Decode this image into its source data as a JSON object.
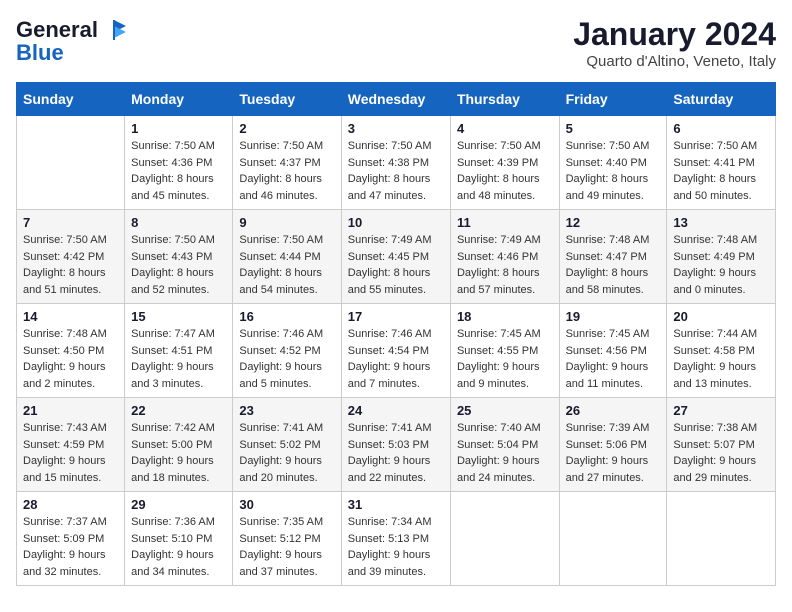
{
  "logo": {
    "line1": "General",
    "line2": "Blue"
  },
  "title": "January 2024",
  "location": "Quarto d'Altino, Veneto, Italy",
  "days_of_week": [
    "Sunday",
    "Monday",
    "Tuesday",
    "Wednesday",
    "Thursday",
    "Friday",
    "Saturday"
  ],
  "weeks": [
    [
      {
        "num": "",
        "sunrise": "",
        "sunset": "",
        "daylight": ""
      },
      {
        "num": "1",
        "sunrise": "Sunrise: 7:50 AM",
        "sunset": "Sunset: 4:36 PM",
        "daylight": "Daylight: 8 hours and 45 minutes."
      },
      {
        "num": "2",
        "sunrise": "Sunrise: 7:50 AM",
        "sunset": "Sunset: 4:37 PM",
        "daylight": "Daylight: 8 hours and 46 minutes."
      },
      {
        "num": "3",
        "sunrise": "Sunrise: 7:50 AM",
        "sunset": "Sunset: 4:38 PM",
        "daylight": "Daylight: 8 hours and 47 minutes."
      },
      {
        "num": "4",
        "sunrise": "Sunrise: 7:50 AM",
        "sunset": "Sunset: 4:39 PM",
        "daylight": "Daylight: 8 hours and 48 minutes."
      },
      {
        "num": "5",
        "sunrise": "Sunrise: 7:50 AM",
        "sunset": "Sunset: 4:40 PM",
        "daylight": "Daylight: 8 hours and 49 minutes."
      },
      {
        "num": "6",
        "sunrise": "Sunrise: 7:50 AM",
        "sunset": "Sunset: 4:41 PM",
        "daylight": "Daylight: 8 hours and 50 minutes."
      }
    ],
    [
      {
        "num": "7",
        "sunrise": "Sunrise: 7:50 AM",
        "sunset": "Sunset: 4:42 PM",
        "daylight": "Daylight: 8 hours and 51 minutes."
      },
      {
        "num": "8",
        "sunrise": "Sunrise: 7:50 AM",
        "sunset": "Sunset: 4:43 PM",
        "daylight": "Daylight: 8 hours and 52 minutes."
      },
      {
        "num": "9",
        "sunrise": "Sunrise: 7:50 AM",
        "sunset": "Sunset: 4:44 PM",
        "daylight": "Daylight: 8 hours and 54 minutes."
      },
      {
        "num": "10",
        "sunrise": "Sunrise: 7:49 AM",
        "sunset": "Sunset: 4:45 PM",
        "daylight": "Daylight: 8 hours and 55 minutes."
      },
      {
        "num": "11",
        "sunrise": "Sunrise: 7:49 AM",
        "sunset": "Sunset: 4:46 PM",
        "daylight": "Daylight: 8 hours and 57 minutes."
      },
      {
        "num": "12",
        "sunrise": "Sunrise: 7:48 AM",
        "sunset": "Sunset: 4:47 PM",
        "daylight": "Daylight: 8 hours and 58 minutes."
      },
      {
        "num": "13",
        "sunrise": "Sunrise: 7:48 AM",
        "sunset": "Sunset: 4:49 PM",
        "daylight": "Daylight: 9 hours and 0 minutes."
      }
    ],
    [
      {
        "num": "14",
        "sunrise": "Sunrise: 7:48 AM",
        "sunset": "Sunset: 4:50 PM",
        "daylight": "Daylight: 9 hours and 2 minutes."
      },
      {
        "num": "15",
        "sunrise": "Sunrise: 7:47 AM",
        "sunset": "Sunset: 4:51 PM",
        "daylight": "Daylight: 9 hours and 3 minutes."
      },
      {
        "num": "16",
        "sunrise": "Sunrise: 7:46 AM",
        "sunset": "Sunset: 4:52 PM",
        "daylight": "Daylight: 9 hours and 5 minutes."
      },
      {
        "num": "17",
        "sunrise": "Sunrise: 7:46 AM",
        "sunset": "Sunset: 4:54 PM",
        "daylight": "Daylight: 9 hours and 7 minutes."
      },
      {
        "num": "18",
        "sunrise": "Sunrise: 7:45 AM",
        "sunset": "Sunset: 4:55 PM",
        "daylight": "Daylight: 9 hours and 9 minutes."
      },
      {
        "num": "19",
        "sunrise": "Sunrise: 7:45 AM",
        "sunset": "Sunset: 4:56 PM",
        "daylight": "Daylight: 9 hours and 11 minutes."
      },
      {
        "num": "20",
        "sunrise": "Sunrise: 7:44 AM",
        "sunset": "Sunset: 4:58 PM",
        "daylight": "Daylight: 9 hours and 13 minutes."
      }
    ],
    [
      {
        "num": "21",
        "sunrise": "Sunrise: 7:43 AM",
        "sunset": "Sunset: 4:59 PM",
        "daylight": "Daylight: 9 hours and 15 minutes."
      },
      {
        "num": "22",
        "sunrise": "Sunrise: 7:42 AM",
        "sunset": "Sunset: 5:00 PM",
        "daylight": "Daylight: 9 hours and 18 minutes."
      },
      {
        "num": "23",
        "sunrise": "Sunrise: 7:41 AM",
        "sunset": "Sunset: 5:02 PM",
        "daylight": "Daylight: 9 hours and 20 minutes."
      },
      {
        "num": "24",
        "sunrise": "Sunrise: 7:41 AM",
        "sunset": "Sunset: 5:03 PM",
        "daylight": "Daylight: 9 hours and 22 minutes."
      },
      {
        "num": "25",
        "sunrise": "Sunrise: 7:40 AM",
        "sunset": "Sunset: 5:04 PM",
        "daylight": "Daylight: 9 hours and 24 minutes."
      },
      {
        "num": "26",
        "sunrise": "Sunrise: 7:39 AM",
        "sunset": "Sunset: 5:06 PM",
        "daylight": "Daylight: 9 hours and 27 minutes."
      },
      {
        "num": "27",
        "sunrise": "Sunrise: 7:38 AM",
        "sunset": "Sunset: 5:07 PM",
        "daylight": "Daylight: 9 hours and 29 minutes."
      }
    ],
    [
      {
        "num": "28",
        "sunrise": "Sunrise: 7:37 AM",
        "sunset": "Sunset: 5:09 PM",
        "daylight": "Daylight: 9 hours and 32 minutes."
      },
      {
        "num": "29",
        "sunrise": "Sunrise: 7:36 AM",
        "sunset": "Sunset: 5:10 PM",
        "daylight": "Daylight: 9 hours and 34 minutes."
      },
      {
        "num": "30",
        "sunrise": "Sunrise: 7:35 AM",
        "sunset": "Sunset: 5:12 PM",
        "daylight": "Daylight: 9 hours and 37 minutes."
      },
      {
        "num": "31",
        "sunrise": "Sunrise: 7:34 AM",
        "sunset": "Sunset: 5:13 PM",
        "daylight": "Daylight: 9 hours and 39 minutes."
      },
      {
        "num": "",
        "sunrise": "",
        "sunset": "",
        "daylight": ""
      },
      {
        "num": "",
        "sunrise": "",
        "sunset": "",
        "daylight": ""
      },
      {
        "num": "",
        "sunrise": "",
        "sunset": "",
        "daylight": ""
      }
    ]
  ]
}
